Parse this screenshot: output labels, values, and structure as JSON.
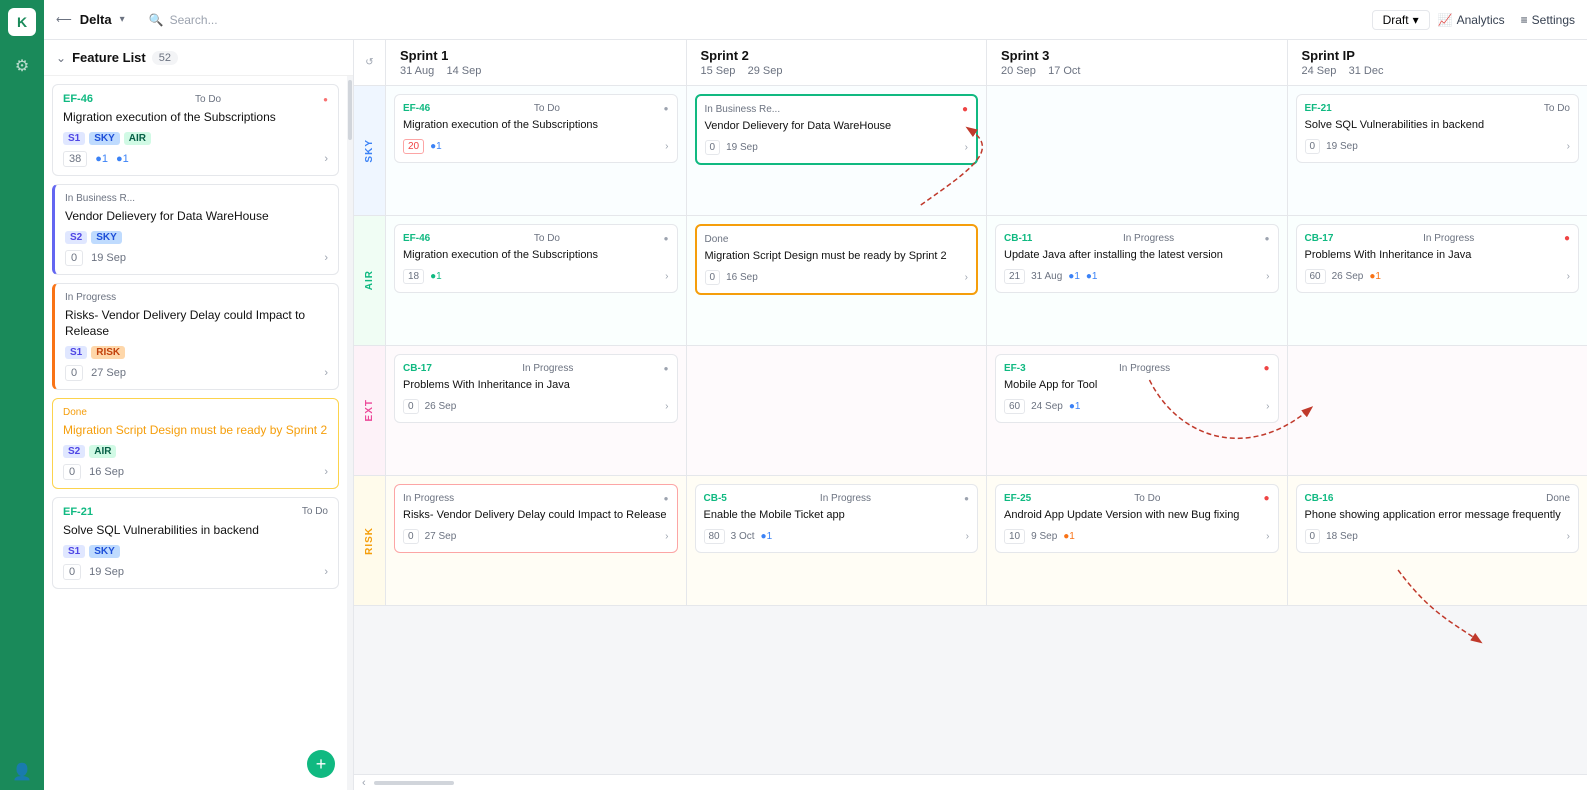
{
  "app": {
    "logo": "K",
    "project": "Delta",
    "draft_label": "Draft",
    "analytics_label": "Analytics",
    "settings_label": "Settings"
  },
  "search": {
    "placeholder": "Search..."
  },
  "feature_list": {
    "title": "Feature List",
    "count": "52",
    "cards": [
      {
        "id": "EF-46",
        "status": "To Do",
        "title": "Migration execution of the Subscriptions",
        "tags": [
          "S1",
          "SKY",
          "AIR"
        ],
        "num": "38",
        "num_type": "normal",
        "dots": "●1 ●1",
        "border": "normal"
      },
      {
        "id": "",
        "status": "In Business R...",
        "title": "Vendor Delievery for Data WareHouse",
        "tags": [
          "S2",
          "SKY"
        ],
        "num": "0",
        "date": "19 Sep",
        "border": "in-business"
      },
      {
        "id": "",
        "status": "In Progress",
        "title": "Risks- Vendor Delivery Delay could Impact to Release",
        "tags": [
          "S1",
          "RISK"
        ],
        "num": "0",
        "date": "27 Sep",
        "border": "in-progress-orange"
      },
      {
        "id": "",
        "status": "Done",
        "title": "Migration Script Design must be ready by Sprint 2",
        "tags": [
          "S2",
          "AIR"
        ],
        "num": "0",
        "date": "16 Sep",
        "border": "done"
      },
      {
        "id": "EF-21",
        "status": "To Do",
        "title": "Solve SQL Vulnerabilities in backend",
        "tags": [
          "S1",
          "SKY"
        ],
        "num": "0",
        "date": "19 Sep",
        "border": "normal"
      }
    ]
  },
  "sprints": [
    {
      "name": "Sprint 1",
      "dates": "31 Aug  14 Sep",
      "id": "sprint1"
    },
    {
      "name": "Sprint 2",
      "dates": "15 Sep  29 Sep",
      "id": "sprint2"
    },
    {
      "name": "Sprint 3",
      "dates": "20 Sep  17 Oct",
      "id": "sprint3"
    },
    {
      "name": "Sprint IP",
      "dates": "24 Sep  31 Dec",
      "id": "sprintip"
    }
  ],
  "rows": [
    {
      "label": "SKY",
      "color": "sky",
      "cells": [
        {
          "cards": [
            {
              "id": "EF-46",
              "status": "To Do",
              "title": "Migration execution of the Subscriptions",
              "num": "20",
              "num_type": "red",
              "dots": "●1",
              "date": "",
              "border": "normal"
            }
          ]
        },
        {
          "cards": [
            {
              "id": "",
              "status": "In Business Re...",
              "title": "Vendor Delievery for Data WareHouse",
              "num": "0",
              "date": "19 Sep",
              "border": "green",
              "dot_red": true
            }
          ]
        },
        {
          "cards": []
        },
        {
          "cards": [
            {
              "id": "EF-21",
              "status": "To Do",
              "title": "Solve SQL Vulnerabilities in backend",
              "num": "0",
              "date": "19 Sep",
              "border": "normal"
            }
          ]
        }
      ]
    },
    {
      "label": "AIR",
      "color": "air",
      "cells": [
        {
          "cards": [
            {
              "id": "EF-46",
              "status": "To Do",
              "title": "Migration execution of the Subscriptions",
              "num": "18",
              "num_type": "normal",
              "dots": "●1",
              "border": "normal"
            }
          ]
        },
        {
          "cards": [
            {
              "id": "",
              "status": "Done",
              "title": "Migration Script Design must be ready by Sprint 2",
              "num": "0",
              "date": "16 Sep",
              "border": "yellow"
            }
          ]
        },
        {
          "cards": [
            {
              "id": "CB-11",
              "status": "In Progress",
              "title": "Update Java after installing the latest version",
              "num": "21",
              "num_type": "normal",
              "date": "31 Aug",
              "dots": "●1 ●1",
              "border": "normal"
            }
          ]
        },
        {
          "cards": [
            {
              "id": "CB-17",
              "status": "In Progress",
              "title": "Problems With Inheritance in Java",
              "num": "60",
              "date": "26 Sep",
              "dots": "●1",
              "border": "normal",
              "dot_red": true
            }
          ]
        }
      ]
    },
    {
      "label": "EXT",
      "color": "ext",
      "cells": [
        {
          "cards": [
            {
              "id": "CB-17",
              "status": "In Progress",
              "title": "Problems With Inheritance in Java",
              "num": "0",
              "date": "26 Sep",
              "border": "normal"
            }
          ]
        },
        {
          "cards": []
        },
        {
          "cards": [
            {
              "id": "EF-3",
              "status": "In Progress",
              "title": "Mobile App for Tool",
              "num": "60",
              "date": "24 Sep",
              "dots": "●1",
              "border": "normal",
              "dot_red": true
            }
          ]
        },
        {
          "cards": []
        }
      ]
    },
    {
      "label": "RISK",
      "color": "risk",
      "cells": [
        {
          "cards": [
            {
              "id": "",
              "status": "In Progress",
              "title": "Risks- Vendor Delivery Delay could Impact to Release",
              "num": "0",
              "date": "27 Sep",
              "border": "red"
            }
          ]
        },
        {
          "cards": [
            {
              "id": "CB-5",
              "status": "In Progress",
              "title": "Enable the Mobile Ticket app",
              "num": "80",
              "num_type": "normal",
              "date": "3 Oct",
              "dots": "●1",
              "border": "normal"
            }
          ]
        },
        {
          "cards": [
            {
              "id": "EF-25",
              "status": "To Do",
              "title": "Android App Update Version with new Bug fixing",
              "num": "10",
              "num_type": "normal",
              "date": "9 Sep",
              "dots": "●1",
              "border": "normal",
              "dot_red": true
            }
          ]
        },
        {
          "cards": [
            {
              "id": "CB-16",
              "status": "Done",
              "title": "Phone showing application error message frequently",
              "num": "0",
              "date": "18 Sep",
              "border": "normal"
            }
          ]
        }
      ]
    }
  ]
}
